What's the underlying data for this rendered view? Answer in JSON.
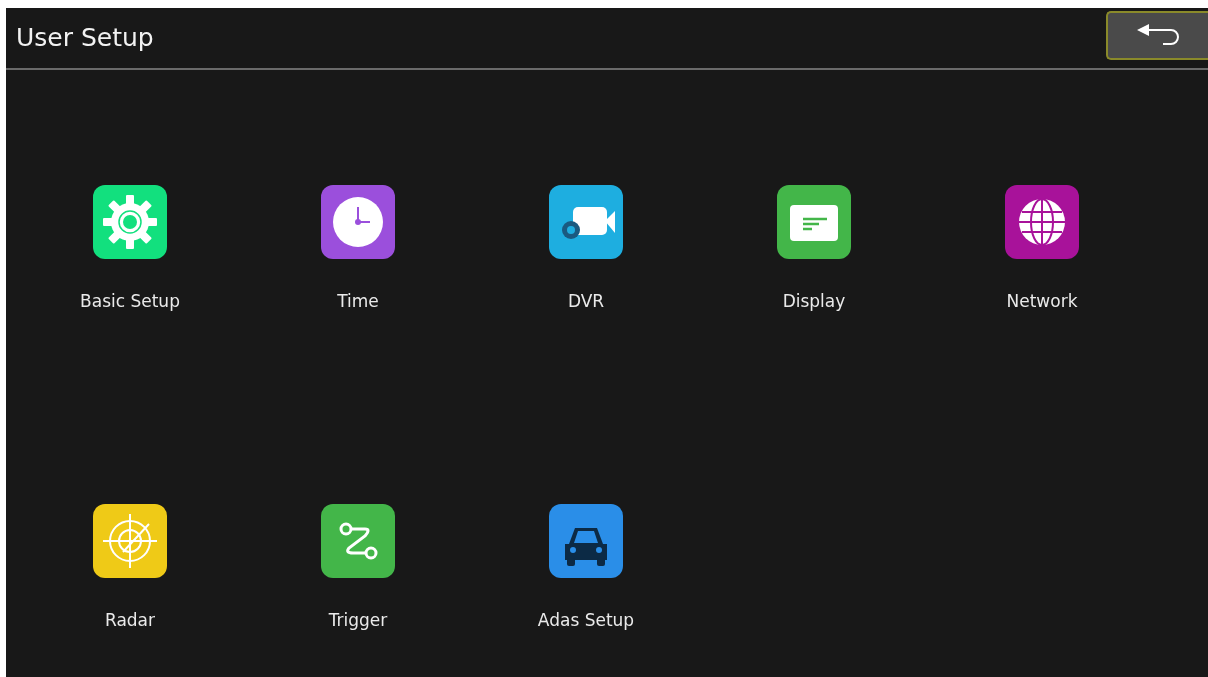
{
  "header": {
    "title": "User Setup"
  },
  "items": [
    {
      "label": "Basic Setup",
      "kind": "gear",
      "color": "#12e07e"
    },
    {
      "label": "Time",
      "kind": "clock",
      "color": "#9b4fdc"
    },
    {
      "label": "DVR",
      "kind": "camera",
      "color": "#1eaee0"
    },
    {
      "label": "Display",
      "kind": "display",
      "color": "#43b649"
    },
    {
      "label": "Network",
      "kind": "globe",
      "color": "#a8129a"
    },
    {
      "label": "Radar",
      "kind": "radar",
      "color": "#efca17"
    },
    {
      "label": "Trigger",
      "kind": "trigger",
      "color": "#43b649"
    },
    {
      "label": "Adas Setup",
      "kind": "car",
      "color": "#2a8ee8"
    }
  ]
}
